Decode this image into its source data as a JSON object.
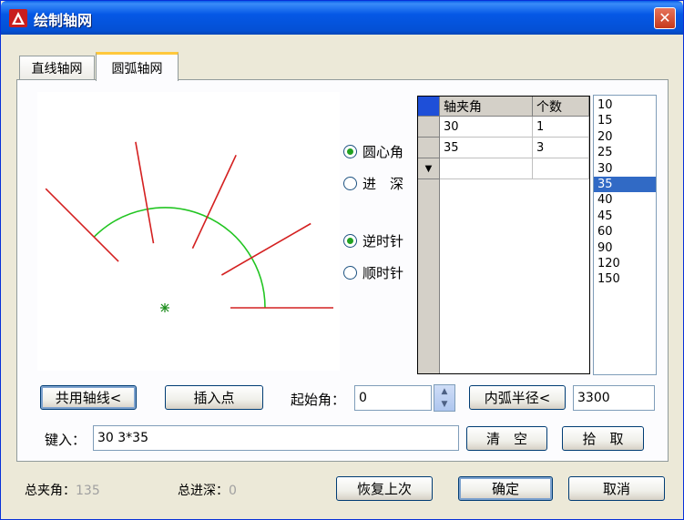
{
  "window": {
    "title": "绘制轴网",
    "close_glyph": "✕"
  },
  "tabs": [
    {
      "label": "直线轴网",
      "active": false
    },
    {
      "label": "圆弧轴网",
      "active": true
    }
  ],
  "angle_mode": {
    "option1": "圆心角",
    "option2": "进　深",
    "selected": "圆心角"
  },
  "direction": {
    "option1": "逆时针",
    "option2": "顺时针",
    "selected": "逆时针"
  },
  "grid": {
    "headers": [
      "轴夹角",
      "个数"
    ],
    "rows": [
      {
        "angle": "30",
        "count": "1"
      },
      {
        "angle": "35",
        "count": "3"
      }
    ],
    "new_row_marker": "▼"
  },
  "value_list": {
    "items": [
      "10",
      "15",
      "20",
      "25",
      "30",
      "35",
      "40",
      "45",
      "60",
      "90",
      "120",
      "150"
    ],
    "selected": "35"
  },
  "controls": {
    "shared_axis_button": "共用轴线<",
    "insert_point_button": "插入点",
    "start_angle_label": "起始角：",
    "start_angle_value": "0",
    "inner_radius_button": "内弧半径<",
    "inner_radius_value": "3300",
    "input_label": "键入：",
    "input_value": "30 3*35",
    "clear_button": "清　空",
    "pick_button": "拾　取"
  },
  "status": {
    "total_angle_label": "总夹角：",
    "total_angle_value": "135",
    "total_depth_label": "总进深：",
    "total_depth_value": "0"
  },
  "footer": {
    "restore_button": "恢复上次",
    "ok_button": "确定",
    "cancel_button": "取消"
  },
  "colors": {
    "axis_line": "#d42020",
    "arc": "#22c522",
    "center_marker": "#1a8c1a",
    "title_bar": "#0558e6",
    "selection": "#316ac5"
  }
}
